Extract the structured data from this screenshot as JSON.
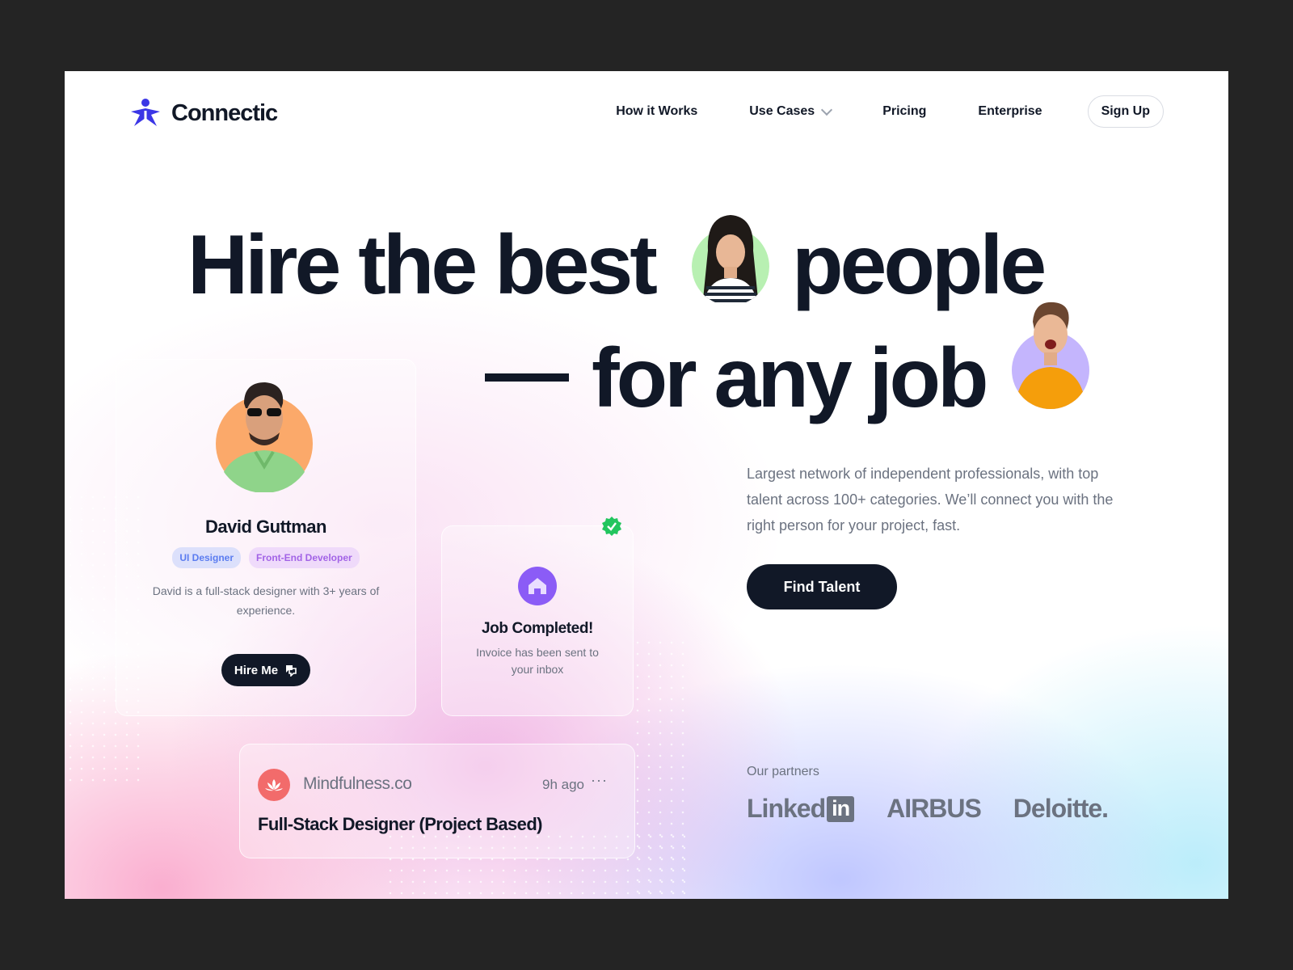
{
  "brand": {
    "name": "Connectic",
    "accent": "#3b36e6"
  },
  "nav": {
    "items": [
      {
        "label": "How it Works"
      },
      {
        "label": "Use Cases",
        "has_dropdown": true
      },
      {
        "label": "Pricing"
      },
      {
        "label": "Enterprise"
      }
    ],
    "signup_label": "Sign Up"
  },
  "hero": {
    "line1_a": "Hire the best",
    "line1_b": "people",
    "line2": "for any job"
  },
  "profile_card": {
    "name": "David Guttman",
    "tags": [
      "UI Designer",
      "Front-End Developer"
    ],
    "description": "David is a full-stack designer with 3+ years of experience.",
    "button_label": "Hire Me"
  },
  "job_card": {
    "title": "Job Completed!",
    "subtitle": "Invoice has been sent to your inbox"
  },
  "post_card": {
    "company": "Mindfulness.co",
    "time": "9h ago",
    "more": "···",
    "title": "Full-Stack Designer (Project Based)"
  },
  "lead": {
    "text": "Largest network of independent professionals, with top talent across 100+ categories. We’ll connect you with the right person for your project, fast.",
    "cta_label": "Find Talent"
  },
  "partners": {
    "label": "Our partners",
    "linkedin_a": "Linked",
    "linkedin_b": "in",
    "airbus": "AIRBUS",
    "deloitte": "Deloitte."
  },
  "colors": {
    "dark": "#111827",
    "muted": "#6b7280",
    "verify_green": "#22c55e",
    "house_purple": "#8b5cf6",
    "lotus_red": "#f26b6b"
  }
}
